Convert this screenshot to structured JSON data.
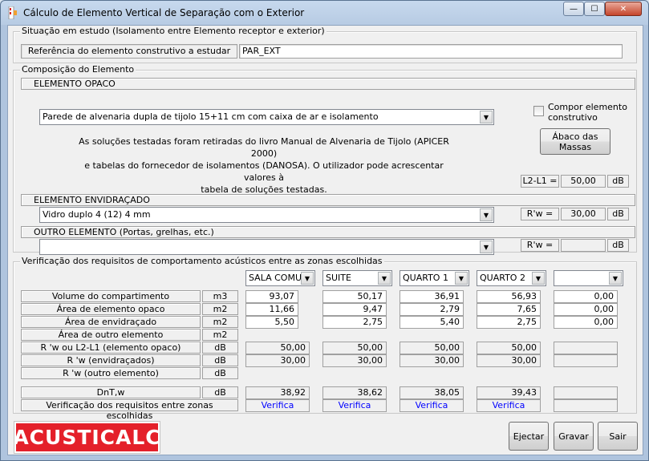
{
  "window": {
    "title": "Cálculo de Elemento Vertical de Separação com o Exterior",
    "controls": {
      "minimize": "—",
      "maximize": "☐",
      "close": "✕"
    }
  },
  "study": {
    "group_title": "Situação em estudo (Isolamento entre Elemento receptor e exterior)",
    "ref_label": "Referência do elemento construtivo a estudar",
    "ref_value": "PAR_EXT"
  },
  "composition": {
    "group_title": "Composição do Elemento",
    "opaque": {
      "header": "ELEMENTO OPACO",
      "selected": "Parede de alvenaria dupla de tijolo 15+11 cm com caixa de ar e isolamento",
      "compose_label": "Compor elemento construtivo",
      "abacus_label": "Ábaco das Massas",
      "info_lines": [
        "As soluções testadas foram retiradas do livro Manual de Alvenaria de Tijolo (APICER 2000)",
        "e tabelas do fornecedor de isolamentos (DANOSA). O utilizador pode acrescentar valores à",
        "tabela de soluções testadas."
      ],
      "value_label": "L2-L1 =",
      "value": "50,00",
      "unit": "dB"
    },
    "glazed": {
      "header": "ELEMENTO ENVIDRAÇADO",
      "selected": "Vidro duplo 4 (12) 4 mm",
      "value_label": "R'w =",
      "value": "30,00",
      "unit": "dB"
    },
    "other": {
      "header": "OUTRO ELEMENTO (Portas, grelhas, etc.)",
      "selected": "",
      "value_label": "R'w =",
      "value": "",
      "unit": "dB"
    }
  },
  "verification": {
    "group_title": "Verificação dos requisitos de comportamento acústicos entre as zonas escolhidas",
    "zones": [
      "SALA COMUM",
      "SUITE",
      "QUARTO 1",
      "QUARTO 2",
      ""
    ],
    "rows": [
      {
        "label": "Volume do compartimento",
        "unit": "m3",
        "values": [
          "93,07",
          "50,17",
          "36,91",
          "56,93",
          "0,00"
        ]
      },
      {
        "label": "Área de elemento opaco",
        "unit": "m2",
        "values": [
          "11,66",
          "9,47",
          "2,79",
          "7,65",
          "0,00"
        ]
      },
      {
        "label": "Área de envidraçado",
        "unit": "m2",
        "values": [
          "5,50",
          "2,75",
          "5,40",
          "2,75",
          "0,00"
        ]
      },
      {
        "label": "Área de outro elemento",
        "unit": "m2",
        "values": [
          "",
          "",
          "",
          "",
          ""
        ]
      },
      {
        "label": "R 'w ou L2-L1 (elemento opaco)",
        "unit": "dB",
        "values": [
          "50,00",
          "50,00",
          "50,00",
          "50,00",
          ""
        ]
      },
      {
        "label": "R 'w (envidraçados)",
        "unit": "dB",
        "values": [
          "30,00",
          "30,00",
          "30,00",
          "30,00",
          ""
        ]
      },
      {
        "label": "R 'w (outro elemento)",
        "unit": "dB",
        "values": [
          "",
          "",
          "",
          "",
          ""
        ]
      }
    ],
    "dnt": {
      "label": "DnT,w",
      "unit": "dB",
      "values": [
        "38,92",
        "38,62",
        "38,05",
        "39,43",
        ""
      ]
    },
    "check": {
      "label": "Verificação dos requisitos entre zonas escolhidas",
      "values": [
        "Verifica",
        "Verifica",
        "Verifica",
        "Verifica",
        ""
      ]
    }
  },
  "footer": {
    "logo": "ACUSTICALC",
    "eject": "Ejectar",
    "save": "Gravar",
    "exit": "Sair"
  }
}
